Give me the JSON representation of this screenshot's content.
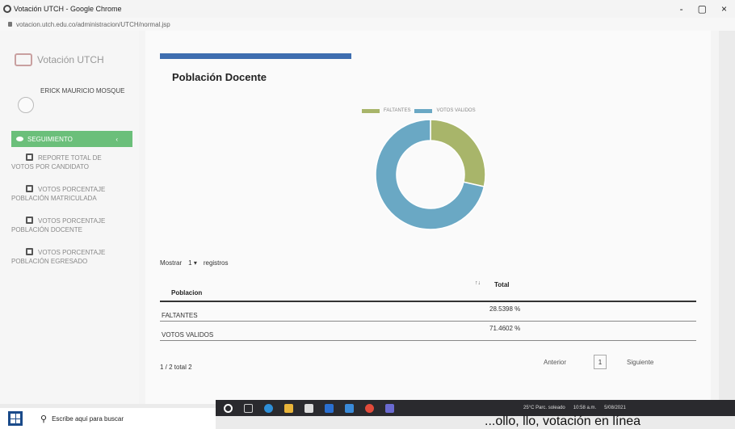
{
  "browser": {
    "window_title": "Votación UTCH - Google Chrome",
    "url": "votacion.utch.edu.co/administracion/UTCH/normal.jsp",
    "controls": [
      "-",
      "▢",
      "×"
    ]
  },
  "sidebar": {
    "brand": "Votación UTCH",
    "user_name": "ERICK MAURICIO MOSQUE",
    "active_item": {
      "label": "SEGUIMIENTO",
      "count": "‹"
    },
    "items": [
      {
        "line1": "REPORTE TOTAL DE",
        "line2": "VOTOS POR CANDIDATO"
      },
      {
        "line1": "VOTOS PORCENTAJE",
        "line2": "POBLACIÓN MATRICULADA"
      },
      {
        "line1": "VOTOS PORCENTAJE",
        "line2": "POBLACIÓN DOCENTE"
      },
      {
        "line1": "VOTOS PORCENTAJE",
        "line2": "POBLACIÓN EGRESADO"
      }
    ]
  },
  "main": {
    "progress": 1.0,
    "title": "Población Docente",
    "legend": [
      {
        "label": "FALTANTES",
        "color": "#a8b56a"
      },
      {
        "label": "VOTOS VALIDOS",
        "color": "#6aa8c4"
      }
    ],
    "mostrar": {
      "prefix": "Mostrar",
      "value": "1",
      "arrow": "▾",
      "suffix": "registros"
    },
    "table": {
      "col_poblacion": "Poblacion",
      "sort_icon": "↑↓",
      "col_total": "Total",
      "rows": [
        {
          "poblacion": "FALTANTES",
          "total": "28.5398 %"
        },
        {
          "poblacion": "VOTOS VALIDOS",
          "total": "71.4602 %"
        }
      ]
    },
    "info": "1 / 2 total 2",
    "pager": {
      "prev": "Anterior",
      "page": "1",
      "next": "Siguiente"
    }
  },
  "chart_data": {
    "type": "pie",
    "categories": [
      "FALTANTES",
      "VOTOS VALIDOS"
    ],
    "values": [
      28.5398,
      71.4602
    ],
    "colors": [
      "#a8b56a",
      "#6aa8c4"
    ],
    "legend_position": "top"
  },
  "taskbar": {
    "search_placeholder": "Escribe aquí para buscar",
    "weather": "25°C  Parc. soleado",
    "time": "10:58 a.m.",
    "date": "5/08/2021"
  },
  "caption": "...ollo, llo, votación en línea"
}
